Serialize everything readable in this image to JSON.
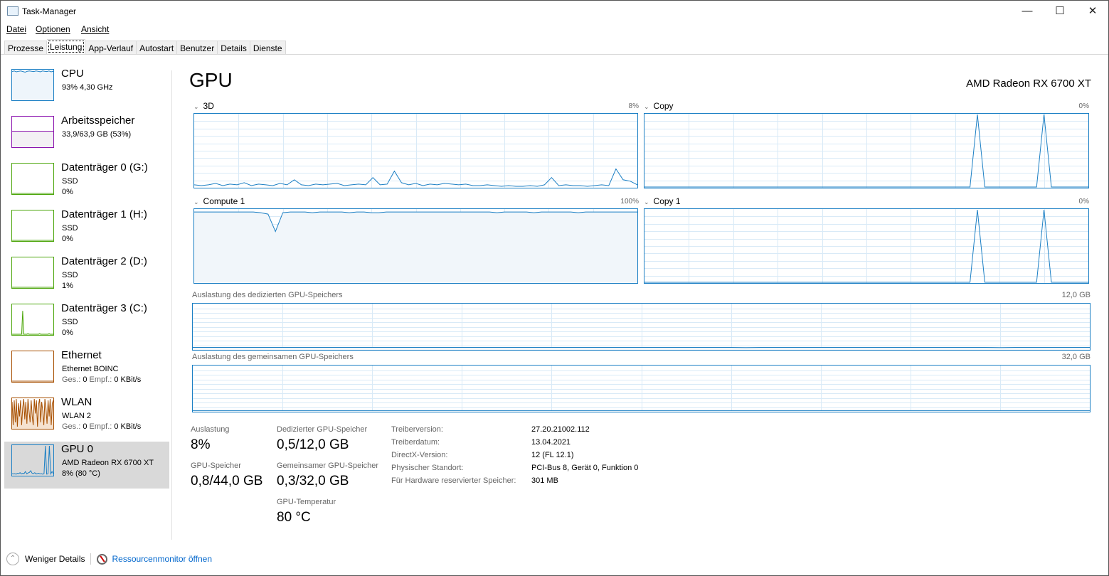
{
  "window": {
    "title": "Task-Manager",
    "controls": [
      "minimize",
      "maximize",
      "close"
    ]
  },
  "menu": [
    "Datei",
    "Optionen",
    "Ansicht"
  ],
  "tabs": [
    "Prozesse",
    "Leistung",
    "App-Verlauf",
    "Autostart",
    "Benutzer",
    "Details",
    "Dienste"
  ],
  "active_tab": "Leistung",
  "sidebar": [
    {
      "name": "CPU",
      "sub1": "93% 4,30 GHz",
      "sub2": "",
      "color": "#1b7fc4",
      "fill": "#eef5fb",
      "values": [
        96,
        98,
        95,
        97,
        98,
        96,
        94,
        97,
        98,
        97,
        96,
        98,
        97,
        95,
        98,
        97,
        96,
        98,
        95,
        97
      ]
    },
    {
      "name": "Arbeitsspeicher",
      "sub1": "33,9/63,9 GB (53%)",
      "sub2": "",
      "color": "#8b12ae",
      "fill": "#f3f0f4",
      "values": [
        53,
        53,
        53,
        53,
        53,
        53,
        53,
        53,
        53,
        53
      ]
    },
    {
      "name": "Datenträger 0 (G:)",
      "sub1": "SSD",
      "sub2": "0%",
      "color": "#4da60c",
      "fill": "#fff",
      "values": [
        0,
        0,
        0,
        0,
        0
      ]
    },
    {
      "name": "Datenträger 1 (H:)",
      "sub1": "SSD",
      "sub2": "0%",
      "color": "#4da60c",
      "fill": "#fff",
      "values": [
        0,
        0,
        0,
        0,
        0
      ]
    },
    {
      "name": "Datenträger 2 (D:)",
      "sub1": "SSD",
      "sub2": "1%",
      "color": "#4da60c",
      "fill": "#fff",
      "values": [
        0,
        0,
        0,
        0,
        0
      ]
    },
    {
      "name": "Datenträger 3 (C:)",
      "sub1": "SSD",
      "sub2": "0%",
      "color": "#4da60c",
      "fill": "#dff0d0",
      "values": [
        0,
        0,
        0,
        0,
        0,
        0,
        0,
        0,
        0,
        0,
        80,
        0,
        0,
        0,
        0,
        2,
        0,
        0,
        0,
        0,
        0,
        0,
        0,
        0,
        0,
        0,
        2,
        0,
        0,
        0,
        0,
        0,
        0,
        0,
        0,
        2,
        0,
        0,
        0,
        0
      ]
    },
    {
      "name": "Ethernet",
      "sub1": "Ethernet BOINC",
      "sub2": "Ges.: 0 Empf.: 0 KBit/s",
      "color": "#a74f01",
      "fill": "#fff",
      "values": [
        0,
        0,
        0,
        0,
        0
      ]
    },
    {
      "name": "WLAN",
      "sub1": "WLAN 2",
      "sub2": "Ges.: 0 Empf.: 0 KBit/s",
      "color": "#a74f01",
      "fill": "#f5e2d0",
      "values": [
        90,
        10,
        95,
        20,
        100,
        5,
        85,
        40,
        95,
        10,
        70,
        100,
        30,
        90,
        15,
        100,
        60,
        20,
        95,
        40,
        10,
        100,
        50,
        95,
        5,
        80,
        100,
        20,
        90,
        60,
        10,
        100,
        70,
        15,
        95,
        40,
        100,
        10,
        85,
        95
      ]
    },
    {
      "name": "GPU 0",
      "sub1": "AMD Radeon RX 6700 XT",
      "sub2": "8% (80 °C)",
      "color": "#1b7fc4",
      "fill": "#fff",
      "values": [
        5,
        4,
        5,
        3,
        6,
        5,
        8,
        4,
        6,
        5,
        12,
        4,
        7,
        9,
        15,
        6,
        5,
        8,
        4,
        5,
        6,
        4,
        5,
        3,
        5,
        100,
        3,
        4,
        100,
        4,
        12,
        5
      ]
    }
  ],
  "main": {
    "title": "GPU",
    "model": "AMD Radeon RX 6700 XT",
    "engines": [
      {
        "label": "3D",
        "value": "8%",
        "fill": false,
        "values": [
          3,
          2,
          3,
          5,
          2,
          4,
          3,
          6,
          2,
          4,
          3,
          2,
          5,
          3,
          10,
          3,
          2,
          4,
          3,
          4,
          5,
          2,
          3,
          4,
          3,
          13,
          3,
          4,
          22,
          6,
          3,
          5,
          2,
          4,
          3,
          5,
          4,
          3,
          4,
          2,
          2,
          3,
          2,
          1,
          2,
          1,
          1,
          2,
          1,
          3,
          13,
          2,
          3,
          2,
          2,
          1,
          2,
          3,
          2,
          25,
          10,
          8,
          3
        ]
      },
      {
        "label": "Copy",
        "value": "0%",
        "fill": false,
        "values": [
          0,
          0,
          0,
          0,
          0,
          0,
          0,
          0,
          0,
          0,
          0,
          0,
          0,
          0,
          0,
          0,
          0,
          0,
          0,
          0,
          0,
          0,
          0,
          0,
          0,
          0,
          0,
          0,
          0,
          0,
          0,
          0,
          0,
          0,
          0,
          0,
          0,
          0,
          0,
          0,
          0,
          0,
          0,
          0,
          0,
          100,
          0,
          0,
          0,
          0,
          0,
          0,
          0,
          0,
          100,
          0,
          0,
          0,
          0,
          0,
          0
        ]
      },
      {
        "label": "Compute 1",
        "value": "100%",
        "fill": true,
        "values": [
          97,
          97,
          97,
          97,
          97,
          97,
          97,
          97,
          97,
          96,
          94,
          70,
          96,
          97,
          97,
          97,
          96,
          97,
          97,
          97,
          97,
          96,
          97,
          97,
          96,
          96,
          97,
          97,
          97,
          97,
          97,
          97,
          97,
          97,
          97,
          97,
          97,
          97,
          97,
          97,
          97,
          96,
          97,
          97,
          97,
          97,
          96,
          97,
          97,
          97,
          97,
          97,
          96,
          97,
          97,
          97,
          97,
          97,
          97,
          97,
          97
        ]
      },
      {
        "label": "Copy 1",
        "value": "0%",
        "fill": false,
        "values": [
          0,
          0,
          0,
          0,
          0,
          0,
          0,
          0,
          0,
          0,
          0,
          0,
          0,
          0,
          0,
          0,
          0,
          0,
          0,
          0,
          0,
          0,
          0,
          0,
          0,
          0,
          0,
          0,
          0,
          0,
          0,
          0,
          0,
          0,
          0,
          0,
          0,
          0,
          0,
          0,
          0,
          0,
          0,
          0,
          0,
          100,
          0,
          0,
          0,
          0,
          0,
          0,
          0,
          0,
          100,
          0,
          0,
          0,
          0,
          0,
          0
        ]
      }
    ],
    "memory": [
      {
        "label": "Auslastung des dedizierten GPU-Speichers",
        "max": "12,0 GB",
        "values": [
          4,
          4,
          4,
          4,
          4,
          4,
          4,
          4,
          4,
          4,
          4,
          4,
          4,
          4,
          4,
          4,
          4,
          4,
          4,
          4,
          4,
          4,
          4,
          4,
          4,
          4,
          4,
          4,
          4,
          4,
          4,
          4,
          4,
          4,
          4,
          4,
          4,
          3.5,
          4,
          4,
          4,
          4,
          4,
          4,
          4,
          4,
          4,
          4,
          4,
          4,
          4,
          4,
          4,
          4,
          3.5,
          4,
          4,
          4,
          4,
          4,
          4
        ]
      },
      {
        "label": "Auslastung des gemeinsamen GPU-Speichers",
        "max": "32,0 GB",
        "values": [
          1,
          1,
          1,
          1,
          1,
          1,
          1,
          1,
          1,
          1,
          1,
          1,
          1,
          1,
          1,
          1,
          1,
          1,
          1,
          1,
          1,
          1,
          1,
          1,
          1,
          1,
          1,
          1,
          1,
          1,
          1,
          1,
          1,
          1,
          1,
          1,
          1,
          1,
          1,
          1,
          1,
          1,
          1,
          1,
          1,
          1,
          1,
          1,
          1,
          1,
          1,
          1,
          1,
          1,
          1,
          1,
          1,
          1,
          1,
          1,
          1
        ]
      }
    ],
    "stats": {
      "util_label": "Auslastung",
      "util": "8%",
      "gpumem_label": "GPU-Speicher",
      "gpumem": "0,8/44,0 GB",
      "ded_label": "Dedizierter GPU-Speicher",
      "ded": "0,5/12,0 GB",
      "shared_label": "Gemeinsamer GPU-Speicher",
      "shared": "0,3/32,0 GB",
      "temp_label": "GPU-Temperatur",
      "temp": "80 °C"
    },
    "info": [
      {
        "k": "Treiberversion:",
        "v": "27.20.21002.112"
      },
      {
        "k": "Treiberdatum:",
        "v": "13.04.2021"
      },
      {
        "k": "DirectX-Version:",
        "v": "12 (FL 12.1)"
      },
      {
        "k": "Physischer Standort:",
        "v": "PCI-Bus 8, Gerät 0, Funktion 0"
      },
      {
        "k": "Für Hardware reservierter Speicher:",
        "v": "301 MB"
      }
    ]
  },
  "footer": {
    "less": "Weniger Details",
    "resmon": "Ressourcenmonitor öffnen"
  },
  "colors": {
    "accent": "#1b7fc4",
    "grid": "#d9eaf7",
    "link": "#0066cc"
  }
}
